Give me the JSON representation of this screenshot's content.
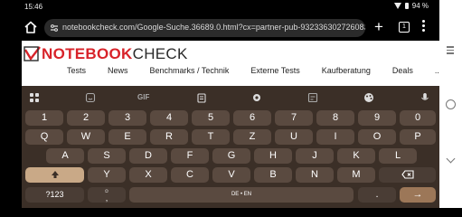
{
  "status": {
    "time": "15:46",
    "battery": "94 %"
  },
  "browser": {
    "url": "notebookcheck.com/Google-Suche.36689.0.html?cx=partner-pub-932336302726083",
    "tabs_count": "1"
  },
  "site": {
    "logo_part1": "NOTEBOOK",
    "logo_part2": "CHECK",
    "nav": [
      "Tests",
      "News",
      "Benchmarks / Technik",
      "Externe Tests",
      "Kaufberatung",
      "Deals",
      "..."
    ]
  },
  "keyboard": {
    "toolbar": [
      "apps-icon",
      "sticker-icon",
      "gif-icon",
      "clipboard-icon",
      "settings-icon",
      "translate-icon",
      "palette-icon",
      "mic-icon"
    ],
    "gif_label": "GIF",
    "number_row": [
      "1",
      "2",
      "3",
      "4",
      "5",
      "6",
      "7",
      "8",
      "9",
      "0"
    ],
    "row1": [
      "Q",
      "W",
      "E",
      "R",
      "T",
      "Z",
      "U",
      "I",
      "O",
      "P"
    ],
    "row2": [
      "A",
      "S",
      "D",
      "F",
      "G",
      "H",
      "J",
      "K",
      "L"
    ],
    "row3": [
      "Y",
      "X",
      "C",
      "V",
      "B",
      "N",
      "M"
    ],
    "symbols_label": "?123",
    "emoji_label": ",",
    "space_label": "DE • EN",
    "period_label": ".",
    "enter_label": "→"
  },
  "colors": {
    "keyboard_bg": "#3b2f27",
    "key": "#5a4a40",
    "accent": "#9c7758",
    "logo_red": "#d8232a"
  }
}
